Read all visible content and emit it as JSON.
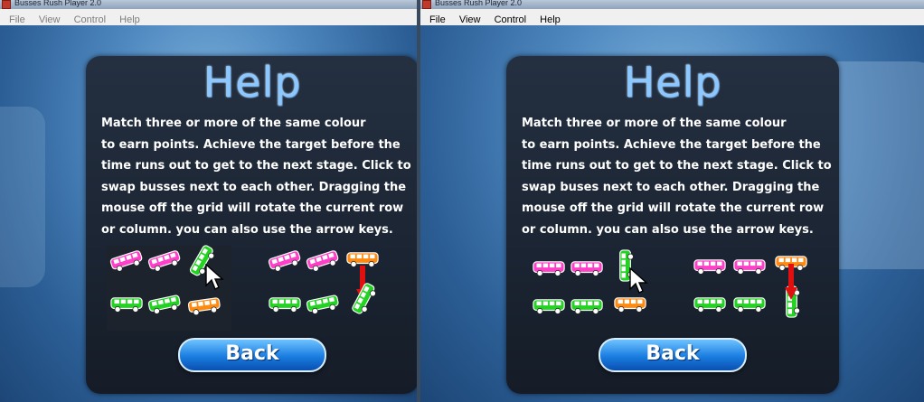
{
  "windows": [
    {
      "title": "Busses Rush Player 2.0",
      "menu": [
        "File",
        "View",
        "Control",
        "Help"
      ],
      "help": {
        "title": "Help",
        "lines": [
          "Match three or more of the same colour",
          "to earn points. Achieve the target before the",
          "time runs out to get to the next stage. Click to",
          "swap busses next to each other. Dragging the",
          "mouse off the grid will rotate the current row",
          "or column. you can also use the arrow keys."
        ],
        "back_label": "Back"
      }
    },
    {
      "title": "Busses Rush Player 2.0",
      "menu": [
        "File",
        "View",
        "Control",
        "Help"
      ],
      "help": {
        "title": "Help",
        "lines": [
          "Match three or more of the same colour",
          "to earn points. Achieve the target before the",
          "time runs out to get to the next stage. Click to",
          "swap buses next to each other. Dragging the",
          "mouse off the grid will rotate the current row",
          "or column. you can also use the arrow keys."
        ],
        "back_label": "Back"
      }
    }
  ],
  "colors": {
    "pink_bus": "#ff3fc8",
    "green_bus": "#22d322",
    "orange_bus": "#ff8a10",
    "arrow_red": "#e01010",
    "help_title": "#8cc8ff",
    "back_button": "#1a7de0"
  },
  "icons": {
    "bus": "bus-icon",
    "cursor": "mouse-cursor-icon",
    "arrow": "down-arrow-icon"
  }
}
